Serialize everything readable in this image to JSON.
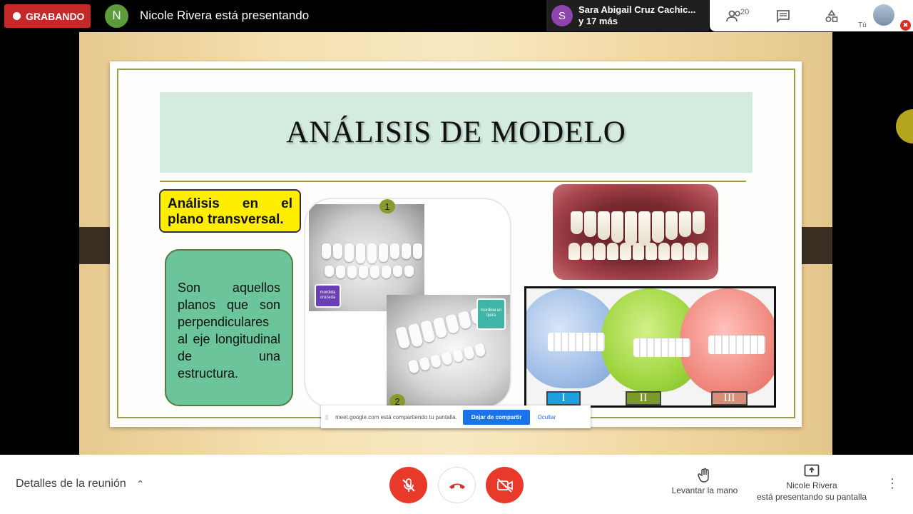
{
  "header": {
    "recording_label": "GRABANDO",
    "presenter_initial": "N",
    "presenter_text": "Nicole Rivera está presentando",
    "participant_initial": "S",
    "participant_name": "Sara Abigail Cruz Cachic...",
    "participant_more": "y 17 más",
    "people_count": "20",
    "self_label": "Tú"
  },
  "slide": {
    "title": "ANÁLISIS DE MODELO",
    "subtitle_line1": "Análisis en el",
    "subtitle_line2": "plano transversal.",
    "definition": "Son aquellos planos que son perpendiculares al eje longitudinal de una estructura.",
    "tag_crossbite": "mordida cruzada",
    "tag_scissor": "mordida en tijera",
    "photo_number_1": "1",
    "photo_number_2": "2",
    "class_labels": [
      "I",
      "II",
      "III"
    ]
  },
  "share_bar": {
    "message": "meet.google.com está compartiendo tu pantalla.",
    "stop_label": "Dejar de compartir",
    "hide_label": "Ocultar"
  },
  "footer": {
    "details_label": "Detalles de la reunión",
    "raise_hand_label": "Levantar la mano",
    "presenting_name": "Nicole Rivera",
    "presenting_text": "está presentando su pantalla"
  },
  "colors": {
    "recording_red": "#c62828",
    "control_red": "#e8392b",
    "share_blue": "#1a73e8",
    "title_band": "#d4ebdf",
    "yellow_box": "#ffee00",
    "green_box": "#6cc49a"
  },
  "icons": {
    "people": "people-icon",
    "chat": "chat-icon",
    "activities": "activities-icon",
    "mic_off": "mic-off-icon",
    "hang_up": "hang-up-icon",
    "camera_off": "camera-off-icon",
    "raise_hand": "hand-icon",
    "present": "present-screen-icon",
    "more": "more-vert-icon"
  }
}
